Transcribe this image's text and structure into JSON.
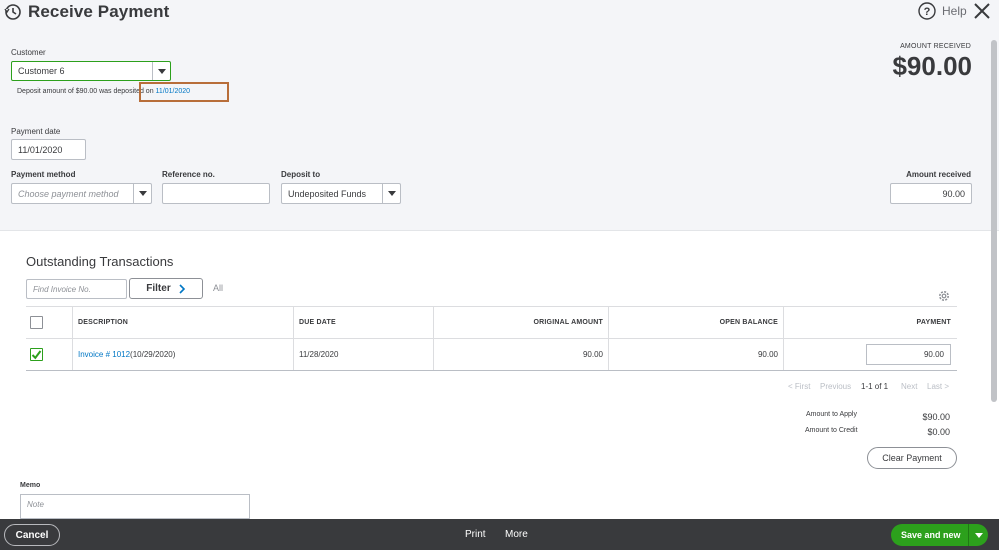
{
  "header": {
    "title": "Receive Payment",
    "help_label": "Help"
  },
  "customer": {
    "label": "Customer",
    "value": "Customer 6",
    "deposit_note_prefix": "Deposit amount of $90.00 was deposited on ",
    "deposit_date_link": "11/01/2020"
  },
  "amount_received_header": {
    "label": "AMOUNT RECEIVED",
    "value": "$90.00"
  },
  "payment_date": {
    "label": "Payment date",
    "value": "11/01/2020"
  },
  "payment_method": {
    "label": "Payment method",
    "placeholder": "Choose payment method"
  },
  "reference_no": {
    "label": "Reference no.",
    "value": ""
  },
  "deposit_to": {
    "label": "Deposit to",
    "value": "Undeposited Funds"
  },
  "amount_received_field": {
    "label": "Amount received",
    "value": "90.00"
  },
  "outstanding": {
    "title": "Outstanding Transactions",
    "find_placeholder": "Find Invoice No.",
    "filter_label": "Filter",
    "all_label": "All",
    "columns": {
      "description": "DESCRIPTION",
      "due_date": "DUE DATE",
      "original_amount": "ORIGINAL AMOUNT",
      "open_balance": "OPEN BALANCE",
      "payment": "PAYMENT"
    },
    "rows": [
      {
        "checked": true,
        "invoice_link": "Invoice # 1012",
        "invoice_date": " (10/29/2020)",
        "due_date": "11/28/2020",
        "original_amount": "90.00",
        "open_balance": "90.00",
        "payment": "90.00"
      }
    ],
    "pager": {
      "first": "< First",
      "previous": "Previous",
      "range": "1-1 of 1",
      "next": "Next",
      "last": "Last >"
    }
  },
  "summary": {
    "amount_to_apply_label": "Amount to Apply",
    "amount_to_apply_value": "$90.00",
    "amount_to_credit_label": "Amount to Credit",
    "amount_to_credit_value": "$0.00",
    "clear_payment_label": "Clear Payment"
  },
  "memo": {
    "label": "Memo",
    "placeholder": "Note"
  },
  "footer": {
    "cancel_label": "Cancel",
    "print_label": "Print",
    "more_label": "More",
    "save_label": "Save and new"
  },
  "colors": {
    "accent_green": "#2ca01c",
    "link_blue": "#0077c5",
    "highlight_box": "#b86e3a",
    "footer_bg": "#393a3d"
  }
}
